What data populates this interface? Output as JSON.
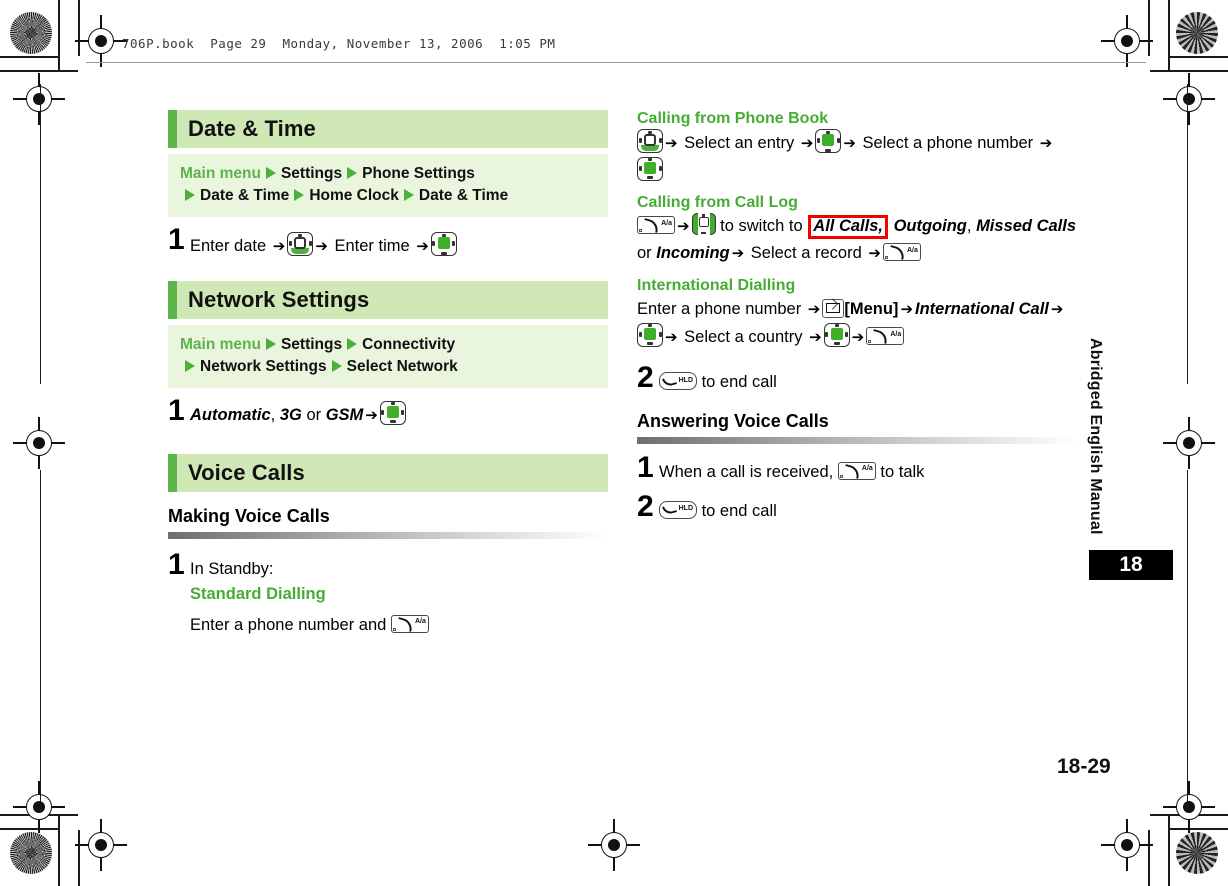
{
  "print_slug": "706P.book  Page 29  Monday, November 13, 2006  1:05 PM",
  "page": {
    "number": "18-29",
    "chapter_number": "18",
    "side_tab_label": "Abridged English Manual"
  },
  "colors": {
    "accent_green_dark": "#5cb54a",
    "section_bar_bg": "#cfe8b6",
    "nav_path_bg": "#e9f5dd",
    "green_text": "#46ad33",
    "annotation_red": "#f40000"
  },
  "left_column": {
    "sections": [
      {
        "title": "Date & Time",
        "nav_path": {
          "root": "Main menu",
          "items": [
            "Settings",
            "Phone Settings",
            "Date & Time",
            "Home Clock",
            "Date & Time"
          ]
        },
        "steps": [
          {
            "number": "1",
            "parts": [
              {
                "type": "text",
                "value": "Enter date "
              },
              {
                "type": "arrow",
                "value": "➔"
              },
              {
                "type": "icon",
                "icon": "nav-key"
              },
              {
                "type": "arrow",
                "value": "➔"
              },
              {
                "type": "text",
                "value": " Enter time "
              },
              {
                "type": "arrow",
                "value": "➔"
              },
              {
                "type": "icon",
                "icon": "center-key"
              }
            ]
          }
        ]
      },
      {
        "title": "Network Settings",
        "nav_path": {
          "root": "Main menu",
          "items": [
            "Settings",
            "Connectivity",
            "Network Settings",
            "Select Network"
          ]
        },
        "steps": [
          {
            "number": "1",
            "parts": [
              {
                "type": "italic",
                "value": "Automatic"
              },
              {
                "type": "text",
                "value": ", "
              },
              {
                "type": "italic",
                "value": "3G"
              },
              {
                "type": "text",
                "value": " or "
              },
              {
                "type": "italic",
                "value": "GSM"
              },
              {
                "type": "arrow",
                "value": "➔"
              },
              {
                "type": "icon",
                "icon": "center-key"
              }
            ]
          }
        ]
      },
      {
        "title": "Voice Calls",
        "subheading": "Making Voice Calls",
        "steps": [
          {
            "number": "1",
            "lines": [
              {
                "style": "plain",
                "text": "In Standby:"
              },
              {
                "style": "green",
                "text": "Standard Dialling"
              },
              {
                "style": "plain-with-key",
                "text": "Enter a phone number and ",
                "icon": "call-key"
              }
            ]
          }
        ]
      }
    ]
  },
  "right_column": {
    "blocks": [
      {
        "kind": "green-head",
        "text": "Calling from Phone Book"
      },
      {
        "kind": "paragraph",
        "parts": [
          {
            "type": "icon",
            "icon": "nav-key"
          },
          {
            "type": "arrow",
            "value": "➔"
          },
          {
            "type": "text",
            "value": " Select an entry "
          },
          {
            "type": "arrow",
            "value": "➔"
          },
          {
            "type": "icon",
            "icon": "center-key"
          },
          {
            "type": "arrow",
            "value": "➔"
          },
          {
            "type": "text",
            "value": " Select a phone number "
          },
          {
            "type": "arrow",
            "value": "➔"
          },
          {
            "type": "icon",
            "icon": "center-key"
          }
        ]
      },
      {
        "kind": "green-head",
        "text": "Calling from Call Log"
      },
      {
        "kind": "paragraph",
        "parts": [
          {
            "type": "icon",
            "icon": "call-key"
          },
          {
            "type": "arrow",
            "value": "➔"
          },
          {
            "type": "icon",
            "icon": "leftright-key"
          },
          {
            "type": "text",
            "value": " to switch to "
          },
          {
            "type": "italic-highlight",
            "value": "All Calls,"
          },
          {
            "type": "italic",
            "value": " Outgoing"
          },
          {
            "type": "text",
            "value": ", "
          },
          {
            "type": "italic",
            "value": "Missed Calls"
          },
          {
            "type": "text",
            "value": " or "
          },
          {
            "type": "italic",
            "value": "Incoming"
          },
          {
            "type": "arrow",
            "value": "➔"
          },
          {
            "type": "text",
            "value": " Select a record "
          },
          {
            "type": "arrow",
            "value": "➔"
          },
          {
            "type": "icon",
            "icon": "call-key"
          }
        ]
      },
      {
        "kind": "green-head",
        "text": "International Dialling"
      },
      {
        "kind": "paragraph",
        "parts": [
          {
            "type": "text",
            "value": "Enter a phone number "
          },
          {
            "type": "arrow",
            "value": "➔"
          },
          {
            "type": "icon",
            "icon": "envelope-key"
          },
          {
            "type": "bold",
            "value": "[Menu]"
          },
          {
            "type": "arrow",
            "value": "➔"
          },
          {
            "type": "italic",
            "value": "International Call"
          },
          {
            "type": "arrow",
            "value": "➔"
          },
          {
            "type": "icon",
            "icon": "center-key"
          },
          {
            "type": "arrow",
            "value": "➔"
          },
          {
            "type": "text",
            "value": " Select a country "
          },
          {
            "type": "arrow",
            "value": "➔"
          },
          {
            "type": "icon",
            "icon": "center-key"
          },
          {
            "type": "arrow",
            "value": "➔"
          },
          {
            "type": "icon",
            "icon": "call-key"
          }
        ]
      },
      {
        "kind": "step",
        "number": "2",
        "icon": "end-key",
        "text": " to end call"
      },
      {
        "kind": "subheading",
        "text": "Answering Voice Calls"
      },
      {
        "kind": "step",
        "number": "1",
        "text_before": "When a call is received, ",
        "icon": "call-key",
        "text": " to talk"
      },
      {
        "kind": "step",
        "number": "2",
        "icon": "end-key",
        "text": " to end call"
      }
    ]
  },
  "icon_names": {
    "nav-key": "navigation-key-icon",
    "center-key": "center-select-key-icon",
    "leftright-key": "left-right-key-icon",
    "call-key": "call-send-key-icon",
    "end-key": "end-power-key-icon",
    "envelope-key": "envelope-menu-key-icon"
  }
}
